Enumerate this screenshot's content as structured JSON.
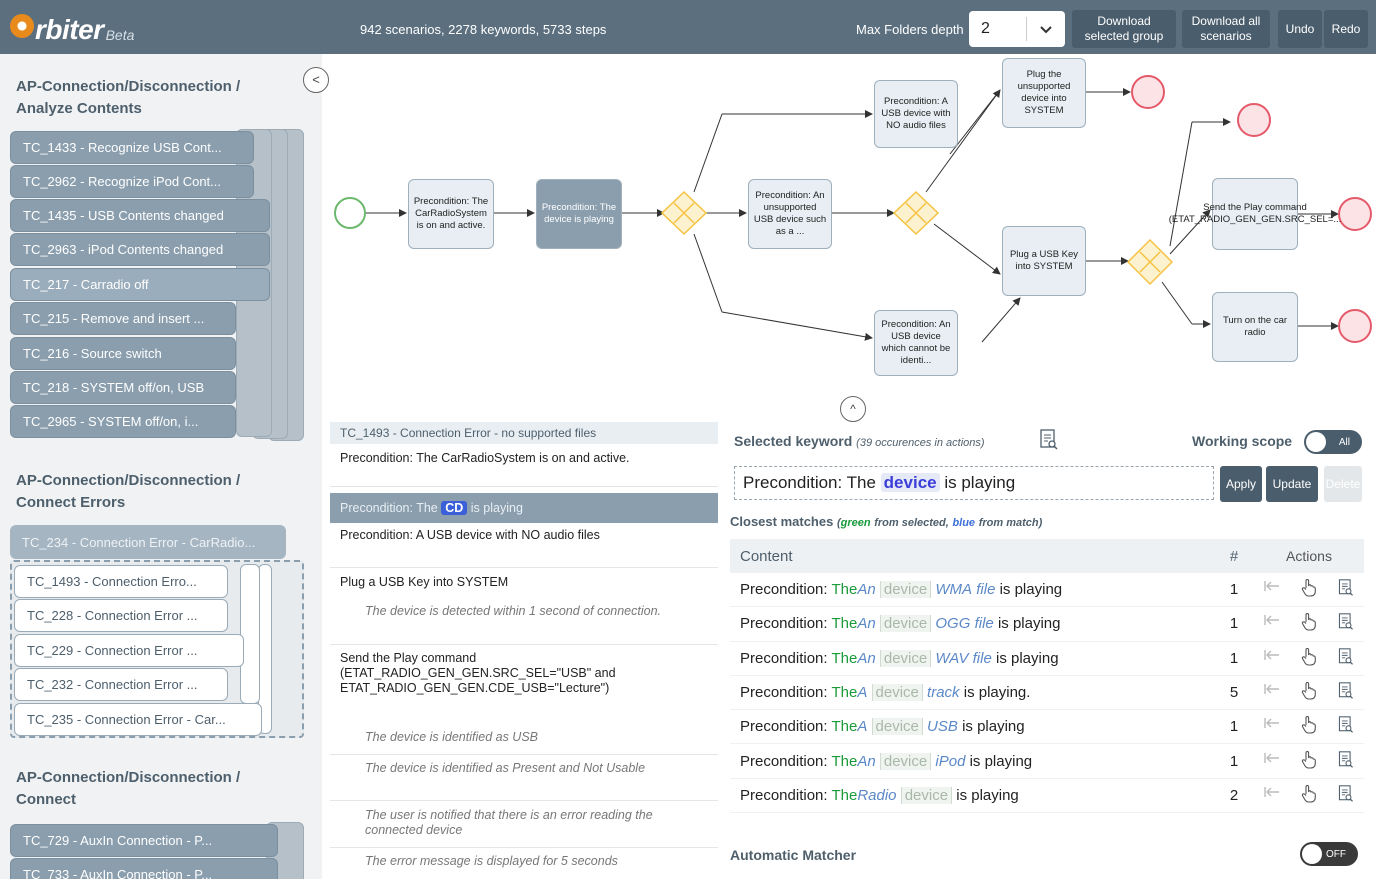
{
  "header": {
    "logo_text": "rbiter",
    "logo_beta": "Beta",
    "stats": "942 scenarios, 2278 keywords, 5733 steps",
    "depth_label": "Max Folders depth",
    "depth_value": "2",
    "download_selected_label": "Download selected group",
    "download_all_label": "Download all scenarios",
    "undo_label": "Undo",
    "redo_label": "Redo"
  },
  "sidebar": {
    "collapse_label": "<",
    "groups": [
      {
        "title": "AP-Connection/Disconnection / Analyze Contents",
        "items": [
          "TC_1433 - Recognize USB Cont...",
          "TC_2962 - Recognize iPod Cont...",
          "TC_1435 - USB Contents changed",
          "TC_2963 - iPod Contents changed",
          "TC_217 - Carradio off",
          "TC_215 - Remove and insert ...",
          "TC_216 - Source switch",
          "TC_218 - SYSTEM off/on, USB",
          "TC_2965 - SYSTEM off/on, i..."
        ]
      },
      {
        "title": "AP-Connection/Disconnection / Connect Errors",
        "header_item": "TC_234 - Connection Error - CarRadio...",
        "items": [
          "TC_1493 - Connection Erro...",
          "TC_228 - Connection Error ...",
          "TC_229 - Connection Error ...",
          "TC_232 - Connection Error ...",
          "TC_235 - Connection Error - Car..."
        ]
      },
      {
        "title": "AP-Connection/Disconnection / Connect",
        "items": [
          "TC_729 - AuxIn Connection - P...",
          "TC_733 - AuxIn Connection - P..."
        ]
      }
    ]
  },
  "graph": {
    "nodes": {
      "n1": "Precondition: The CarRadioSystem is on and active.",
      "n2": "Precondition: The device is playing",
      "n3": "Precondition: An unsupported USB device such as a ...",
      "n4": "Precondition: A USB device with NO audio files",
      "n5": "Plug the unsupported device into SYSTEM",
      "n6": "Plug a USB Key into SYSTEM",
      "n7": "Precondition: An USB device which cannot be identi...",
      "n8": "Send the Play command (ETAT_RADIO_GEN_GEN.SRC_SEL=...",
      "n9": "Turn on the car radio"
    },
    "toggle_label": "^"
  },
  "steps": {
    "title": "TC_1493 - Connection Error - no supported files",
    "s1": "Precondition: The CarRadioSystem is on and active.",
    "s2_pre": "Precondition: The",
    "s2_chip": "CD",
    "s2_post": "is playing",
    "s3": "Precondition: A USB device with NO audio files",
    "s4": "Plug a USB Key into SYSTEM",
    "s4a": "The device is detected within 1 second of connection.",
    "s5": "Send the Play command (ETAT_RADIO_GEN_GEN.SRC_SEL=\"USB\" and ETAT_RADIO_GEN_GEN.CDE_USB=\"Lecture\")",
    "s5a": "The device is identified as USB",
    "s5b": "The device is identified as Present and Not Usable",
    "s5c": "The user is notified that there is an error reading the connected device",
    "s5d": "The error message is displayed for 5 seconds"
  },
  "keyword": {
    "label": "Selected keyword",
    "count": "(39 occurences in actions)",
    "scope_label": "Working scope",
    "scope_toggle": "All",
    "input_pre": "Precondition: The",
    "input_chip": "device",
    "input_post": "is playing",
    "apply_label": "Apply",
    "update_label": "Update",
    "delete_label": "Delete",
    "closest_label": "Closest matches",
    "legend_open": "(",
    "legend_green": "green",
    "legend_from_sel": "from selected,",
    "legend_blue": "blue",
    "legend_from_match": "from match)",
    "col_content": "Content",
    "col_num": "#",
    "col_actions": "Actions",
    "rows": [
      {
        "pre": "Precondition:",
        "g": "The",
        "b": "An",
        "chip": "device",
        "b2": "WMA",
        "b3": "file",
        "post": "is playing",
        "n": "1"
      },
      {
        "pre": "Precondition:",
        "g": "The",
        "b": "An",
        "chip": "device",
        "b2": "OGG",
        "b3": "file",
        "post": "is playing",
        "n": "1"
      },
      {
        "pre": "Precondition:",
        "g": "The",
        "b": "An",
        "chip": "device",
        "b2": "WAV",
        "b3": "file",
        "post": "is playing",
        "n": "1"
      },
      {
        "pre": "Precondition:",
        "g": "The",
        "b": "A",
        "chip": "device",
        "b2": "track",
        "b3": "",
        "post": "is playing.",
        "n": "5"
      },
      {
        "pre": "Precondition:",
        "g": "The",
        "b": "A",
        "chip": "device",
        "b2": "USB",
        "b3": "",
        "post": "is playing",
        "n": "1"
      },
      {
        "pre": "Precondition:",
        "g": "The",
        "b": "An",
        "chip": "device",
        "b2": "iPod",
        "b3": "",
        "post": "is playing",
        "n": "1"
      },
      {
        "pre": "Precondition:",
        "g": "The",
        "b": "Radio",
        "chip": "device",
        "b2": "",
        "b3": "",
        "post": "is playing",
        "n": "2"
      }
    ],
    "auto_label": "Automatic Matcher",
    "auto_toggle": "OFF"
  },
  "colors": {
    "header_bg": "#5b6f7f",
    "start_node": "#6cb86c",
    "end_node": "#e55a6a",
    "gateway": "#f5c242"
  }
}
